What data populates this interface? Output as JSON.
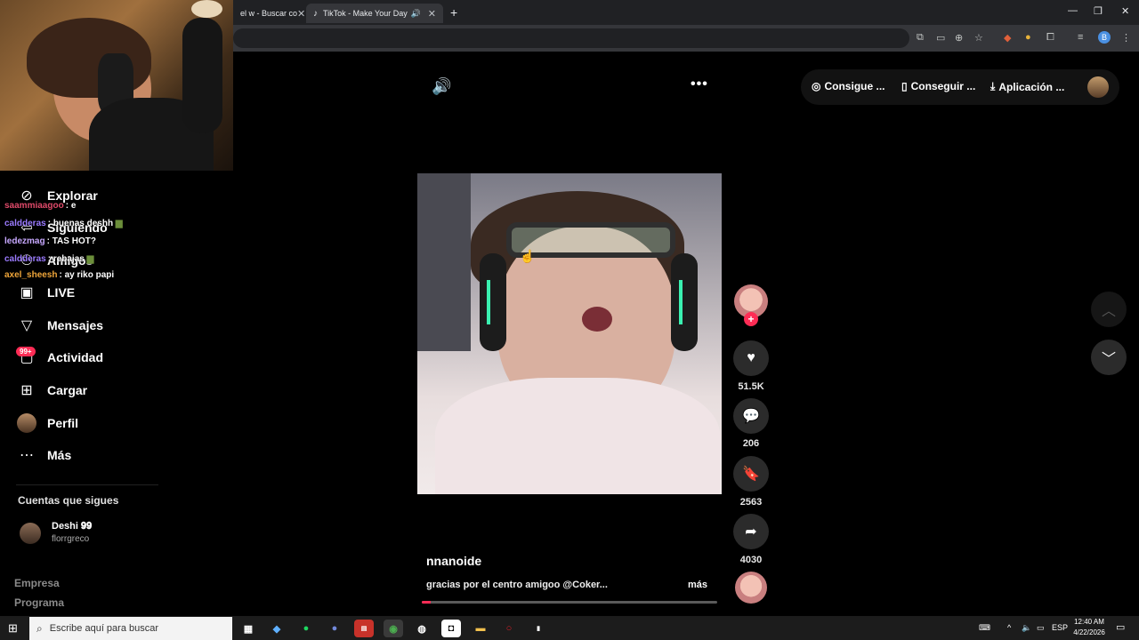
{
  "browser": {
    "tabs": [
      {
        "title": "el w - Buscar co",
        "close": "✕"
      },
      {
        "title": "TikTok - Make Your Day",
        "close": "✕"
      }
    ],
    "new_tab": "+",
    "window_controls": {
      "minimize": "—",
      "restore": "❐",
      "close": "✕"
    },
    "profile_initial": "B"
  },
  "sidebar": {
    "items": [
      {
        "label": "Explorar",
        "icon": "compass-icon"
      },
      {
        "label": "Siguiendo",
        "icon": "following-icon"
      },
      {
        "label": "Amigos",
        "icon": "friends-icon"
      },
      {
        "label": "LIVE",
        "icon": "live-icon"
      },
      {
        "label": "Mensajes",
        "icon": "messages-icon"
      },
      {
        "label": "Actividad",
        "icon": "activity-icon"
      },
      {
        "label": "Cargar",
        "icon": "upload-icon"
      },
      {
        "label": "Perfil",
        "icon": "profile-icon"
      },
      {
        "label": "Más",
        "icon": "more-icon"
      }
    ],
    "activity_badge": "99+",
    "following_title": "Cuentas que sigues",
    "following": [
      {
        "name": "Deshi 𝟗𝟗",
        "handle": "florrgreco"
      }
    ],
    "footer": [
      "Empresa",
      "Programa"
    ]
  },
  "chat": [
    {
      "user": "saammiaagoo",
      "msg": "e",
      "color": "#e04a6a"
    },
    {
      "user": "caldderas",
      "msg": "buenas deshh",
      "color": "#9b7bff"
    },
    {
      "user": "ledezmag",
      "msg": "TAS HOT?",
      "color": "#c7a8ff"
    },
    {
      "user": "caldderas",
      "msg": "rebajas",
      "color": "#9b7bff"
    },
    {
      "user": "axel_sheesh",
      "msg": "ay riko papi",
      "color": "#f0a63a"
    }
  ],
  "topbar": {
    "buttons": [
      {
        "label": "Consigue ...",
        "icon": "coin-icon"
      },
      {
        "label": "Conseguir ...",
        "icon": "phone-icon"
      },
      {
        "label": "Aplicación ...",
        "icon": "download-icon"
      }
    ]
  },
  "video": {
    "author": "nnanoide",
    "caption": "gracias por el centro amigoo @Coker...",
    "more": "más",
    "progress": 0.03
  },
  "actions": {
    "likes": "51.5K",
    "comments": "206",
    "saves": "2563",
    "shares": "4030"
  },
  "taskbar": {
    "search_placeholder": "Escribe aquí para buscar",
    "language": "ESP",
    "time": "12:40 AM",
    "date": "4/22/2026"
  }
}
